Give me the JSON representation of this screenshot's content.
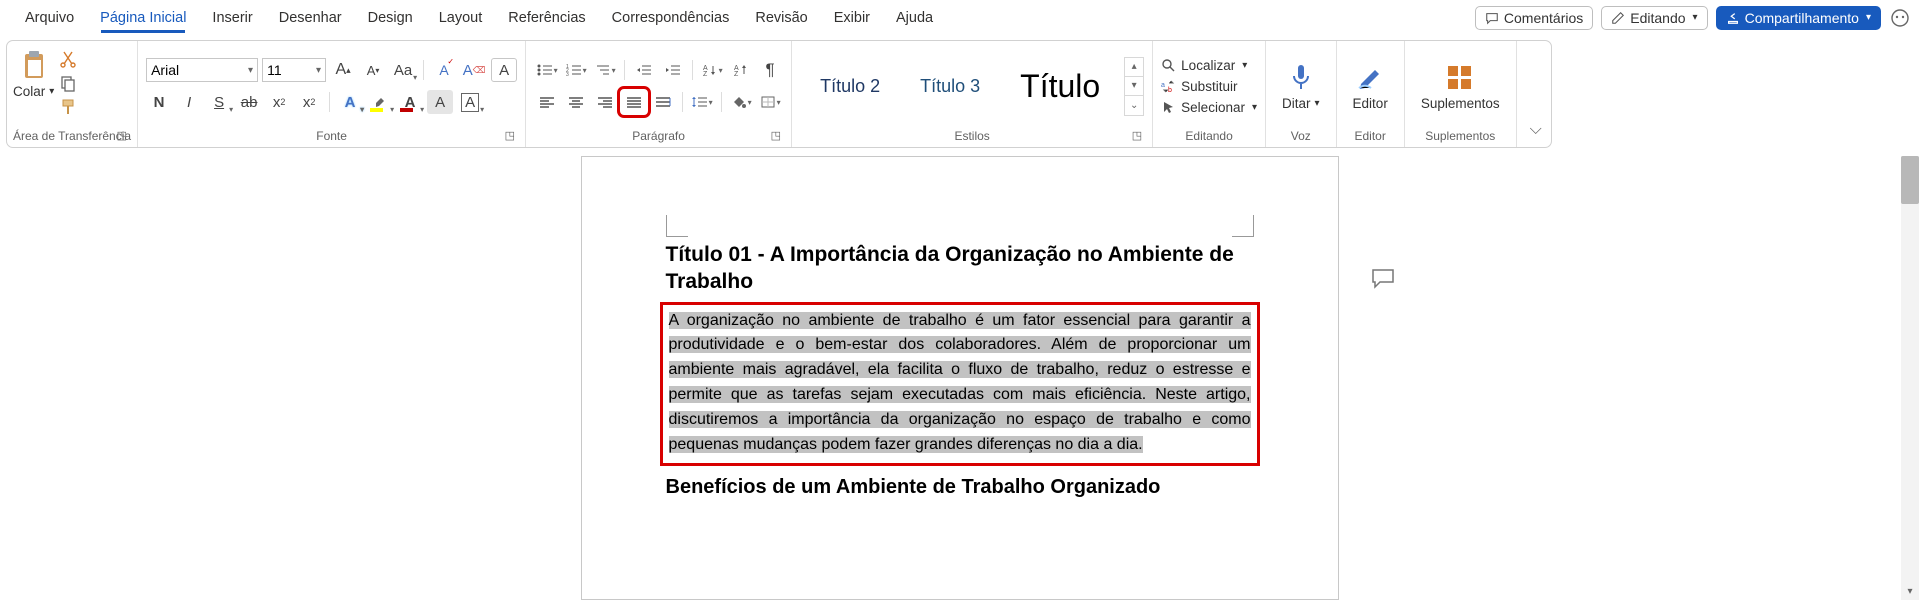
{
  "menu": {
    "tabs": [
      "Arquivo",
      "Página Inicial",
      "Inserir",
      "Desenhar",
      "Design",
      "Layout",
      "Referências",
      "Correspondências",
      "Revisão",
      "Exibir",
      "Ajuda"
    ],
    "active_index": 1
  },
  "titlebar_buttons": {
    "comments": "Comentários",
    "editing": "Editando",
    "share": "Compartilhamento"
  },
  "ribbon": {
    "clipboard": {
      "paste": "Colar",
      "group": "Área de Transferência"
    },
    "font": {
      "name": "Arial",
      "size": "11",
      "group": "Fonte"
    },
    "paragraph": {
      "group": "Parágrafo"
    },
    "styles": {
      "tiles": [
        "Título 2",
        "Título 3",
        "Título"
      ],
      "group": "Estilos"
    },
    "editing": {
      "find": "Localizar",
      "replace": "Substituir",
      "select": "Selecionar",
      "group": "Editando"
    },
    "voice": {
      "dictate": "Ditar",
      "group": "Voz"
    },
    "editor_grp": {
      "editor": "Editor",
      "group": "Editor"
    },
    "addins": {
      "addins": "Suplementos",
      "group": "Suplementos"
    }
  },
  "document": {
    "title1": "Título 01 - A Importância da Organização no Ambiente de Trabalho",
    "paragraph1": "A organização no ambiente de trabalho é um fator essencial para garantir a produtividade e o bem-estar dos colaboradores. Além de proporcionar um ambiente mais agradável, ela facilita o fluxo de trabalho, reduz o estresse e permite que as tarefas sejam executadas com mais eficiência. Neste artigo, discutiremos a importância da organização no espaço de trabalho e como pequenas mudanças podem fazer grandes diferenças no dia a dia.",
    "title2": "Benefícios de um Ambiente de Trabalho Organizado"
  }
}
